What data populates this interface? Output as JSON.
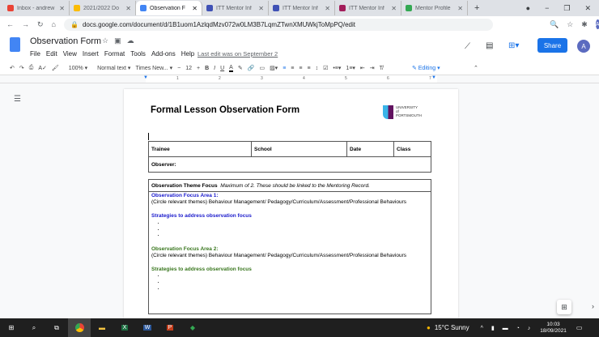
{
  "browser": {
    "tabs": [
      {
        "label": "Inbox - andrew",
        "color": "#ea4335"
      },
      {
        "label": "2021/2022 Do",
        "color": "#fbbc04"
      },
      {
        "label": "Observation F",
        "color": "#4285f4",
        "active": true
      },
      {
        "label": "ITT Mentor Inf",
        "color": "#3f51b5"
      },
      {
        "label": "ITT Mentor Inf",
        "color": "#3f51b5"
      },
      {
        "label": "ITT Mentor Inf",
        "color": "#a21d5a"
      },
      {
        "label": "Mentor Profile",
        "color": "#34a853"
      }
    ],
    "url": "docs.google.com/document/d/1B1uom1AzlqdMzv072w0LM3B7LqmZTwnXMUWkjToMpPQ/edit"
  },
  "docs": {
    "title": "Observation Form",
    "menu": [
      "File",
      "Edit",
      "View",
      "Insert",
      "Format",
      "Tools",
      "Add-ons",
      "Help"
    ],
    "last_edit": "Last edit was on September 2",
    "share": "Share",
    "avatar": "A"
  },
  "toolbar": {
    "zoom": "100%",
    "style": "Normal text",
    "font": "Times New...",
    "size": "12",
    "mode": "Editing"
  },
  "ruler": [
    "1",
    "2",
    "3",
    "4",
    "5",
    "6",
    "7"
  ],
  "doc": {
    "heading": "Formal Lesson Observation Form",
    "logo_text": "UNIVERSITY of PORTSMOUTH",
    "table1": {
      "headers": [
        "Trainee",
        "School",
        "Date",
        "Class"
      ],
      "observer": "Observer:"
    },
    "theme_focus": "Observation Theme Focus",
    "theme_note": "Maximum of 2. These should be linked to the Mentoring Record.",
    "area1": "Observation Focus Area 1:",
    "area1_themes": "(Circle relevant themes) Behaviour Management/ Pedagogy/Curriculum/Assessment/Professional Behaviours",
    "strategies1": "Strategies to address observation focus",
    "area2": "Observation Focus Area 2:",
    "area2_themes": "(Circle relevant themes) Behaviour Management/ Pedagogy/Curriculum/Assessment/Professional Behaviours",
    "strategies2": "Strategies to address observation focus"
  },
  "taskbar": {
    "weather": "15°C  Sunny",
    "time": "10:03",
    "date": "18/09/2021"
  }
}
